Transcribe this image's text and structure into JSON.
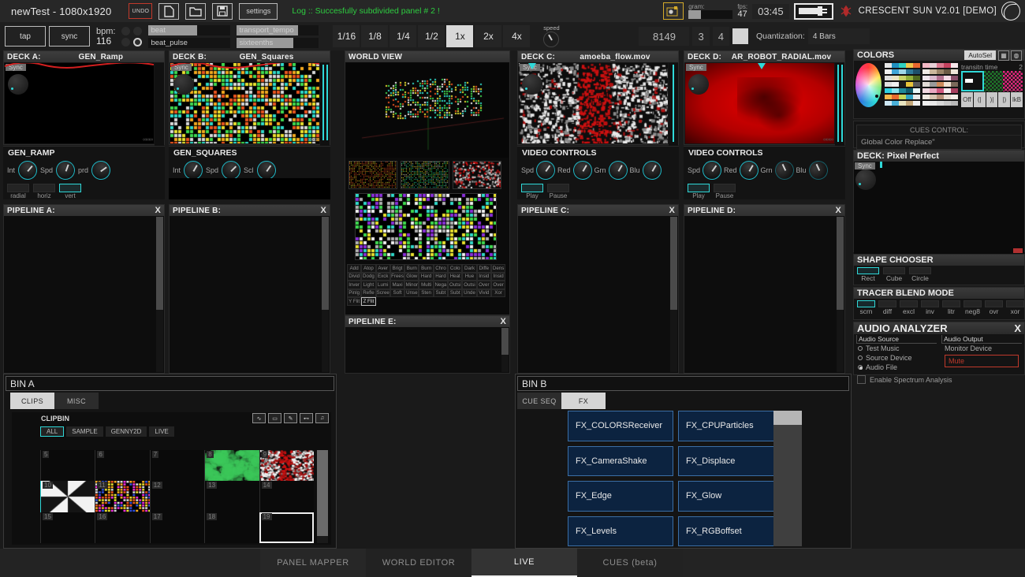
{
  "topbar": {
    "project_title": "newTest - 1080x1920",
    "undo_label": "UNDO",
    "new_icon": "new-document-icon",
    "open_icon": "open-folder-icon",
    "save_icon": "save-disk-icon",
    "settings_label": "settings",
    "log_text": "Log :: Succesfully subdivided panel # 2 !",
    "record_icon": "record-icon",
    "gram_label": "gram:",
    "gram_value": 28,
    "fps_label": "fps:",
    "fps_value": "47",
    "clock": "03:45",
    "plug_icon": "plug-icon",
    "bug_icon": "bug-icon",
    "app_name": "CRESCENT SUN V2.01 [DEMO]",
    "logo_icon": "crescent-sun-logo"
  },
  "transport": {
    "tap_label": "tap",
    "sync_label": "sync",
    "bpm_label": "bpm:",
    "bpm_value": "116",
    "slot_beat": "beat",
    "slot_beat_pulse": "beat_pulse",
    "slot_transport_tempo": "transport_tempo",
    "slot_sixteenths": "sixteenths",
    "divisions": [
      "1/16",
      "1/8",
      "1/4",
      "1/2",
      "1x",
      "2x",
      "4x"
    ],
    "active_division": "1x",
    "speed_label": "speed",
    "frame_count": "8149",
    "bar_count": "3",
    "beat_count": "4",
    "quantization_label": "Quantization:",
    "quantization_value": "4 Bars"
  },
  "decks": [
    {
      "id": "A",
      "label": "DECK A:",
      "source": "GEN_Ramp",
      "sync_label": "Sync",
      "ctrl_title": "GEN_RAMP",
      "knobs": [
        {
          "label": "Int",
          "angle": 40
        },
        {
          "label": "Spd",
          "angle": 20
        },
        {
          "label": "prd",
          "angle": 55
        }
      ],
      "buttons": [
        "radial",
        "horiz",
        "vert"
      ],
      "selected_button": "vert"
    },
    {
      "id": "B",
      "label": "DECK B:",
      "source": "GEN_Squares",
      "sync_label": "Sync",
      "ctrl_title": "GEN_SQUARES",
      "knobs": [
        {
          "label": "Int",
          "angle": 30
        },
        {
          "label": "Spd",
          "angle": 45
        },
        {
          "label": "Scl",
          "angle": 35
        }
      ],
      "buttons": [],
      "selected_button": ""
    },
    {
      "id": "C",
      "label": "DECK C:",
      "source": "amoeba_flow.mov",
      "sync_label": "Sync",
      "ctrl_title": "VIDEO CONTROLS",
      "knobs": [
        {
          "label": "Spd",
          "angle": 35
        },
        {
          "label": "Red",
          "angle": 30
        },
        {
          "label": "Grn",
          "angle": 30
        },
        {
          "label": "Blu",
          "angle": 30
        }
      ],
      "buttons": [
        "Play",
        "Pause"
      ],
      "selected_button": "Play"
    },
    {
      "id": "D",
      "label": "DECK D:",
      "source": "AR_ROBOT_RADIAL.mov",
      "sync_label": "Sync",
      "ctrl_title": "VIDEO CONTROLS",
      "knobs": [
        {
          "label": "Spd",
          "angle": 35
        },
        {
          "label": "Red",
          "angle": 30
        },
        {
          "label": "Grn",
          "angle": -20
        },
        {
          "label": "Blu",
          "angle": -20
        }
      ],
      "buttons": [
        "Play",
        "Pause"
      ],
      "selected_button": "Play"
    }
  ],
  "pipelines": [
    {
      "label": "PIPELINE A:",
      "close": "X"
    },
    {
      "label": "PIPELINE B:",
      "close": "X"
    },
    {
      "label": "PIPELINE C:",
      "close": "X"
    },
    {
      "label": "PIPELINE D:",
      "close": "X"
    },
    {
      "label": "PIPELINE E:",
      "close": "X"
    }
  ],
  "worldview": {
    "title": "WORLD VIEW",
    "blend_modes": [
      "Add",
      "Atop",
      "Aver",
      "Brigt",
      "Burn",
      "Burn",
      "Chro",
      "Colo",
      "Dark",
      "Diffe",
      "Dens",
      "Divid",
      "Dodg",
      "Exck",
      "Frees",
      "Glow",
      "Hard",
      "Hard",
      "Heat",
      "Hue",
      "Insid",
      "Insid",
      "Inver",
      "Light",
      "Lumi",
      "Maxi",
      "Minor",
      "Multi",
      "Nega",
      "Outsi",
      "Outsi",
      "Over",
      "Over",
      "Pinlg",
      "Refle",
      "Scree",
      "Soft",
      "Unse",
      "Sten",
      "Subt",
      "Subt",
      "Unde",
      "Vivid",
      "Xor",
      "Y Flit",
      "Z Flit"
    ],
    "selected_blend_mode": "Z Flit"
  },
  "colors": {
    "title": "COLORS",
    "autosel_label": "AutoSel",
    "icon1": "grid-icon",
    "icon2": "globe-icon",
    "transition_time_label": "transitn time",
    "transition_time_value": "2",
    "phase_buttons": [
      "Off",
      "(|",
      ")|",
      "|)",
      "lkB"
    ],
    "selected_phase": "Off",
    "cues_control_label": "CUES CONTROL:",
    "cues_control_value": "Global Color Replace\""
  },
  "pixel_perfect": {
    "title": "DECK: Pixel Perfect",
    "sync_label": "Sync"
  },
  "shape_chooser": {
    "title": "SHAPE CHOOSER",
    "options": [
      "Rect",
      "Cube",
      "Circle"
    ],
    "selected": "Rect"
  },
  "tracer_blend": {
    "title": "TRACER BLEND MODE",
    "options": [
      "scrn",
      "diff",
      "excl",
      "inv",
      "litr",
      "neg8",
      "ovr",
      "xor"
    ],
    "selected": "scrn"
  },
  "audio_analyzer": {
    "title": "AUDIO ANALYZER",
    "close": "X",
    "source_header": "Audio Source",
    "source_options": [
      "Test Music",
      "Source Device",
      "Audio File"
    ],
    "selected_source": "Audio File",
    "output_header": "Audio Output",
    "output_options": [
      "Monitor Device"
    ],
    "mute_label": "Mute",
    "spectrum_label": "Enable Spectrum Analysis",
    "spectrum_enabled": false
  },
  "bin_a": {
    "title": "BIN A",
    "tabs": [
      "CLIPS",
      "MISC"
    ],
    "active_tab": "CLIPS",
    "clipbin_label": "CLIPBIN",
    "icons": [
      "wav-icon",
      "video-icon",
      "tag-icon",
      "midi-icon",
      "audio-note-icon"
    ],
    "filters": [
      "ALL",
      "SAMPLE",
      "GENNY2D",
      "LIVE"
    ],
    "active_filter": "ALL",
    "cells": [
      {
        "num": "5",
        "type": "empty"
      },
      {
        "num": "6",
        "type": "empty"
      },
      {
        "num": "7",
        "type": "empty"
      },
      {
        "num": "8",
        "type": "green"
      },
      {
        "num": "9",
        "type": "amoeba"
      },
      {
        "num": "10",
        "type": "pinwheel",
        "selected": true
      },
      {
        "num": "11",
        "type": "squares"
      },
      {
        "num": "12",
        "type": "empty"
      },
      {
        "num": "13",
        "type": "empty"
      },
      {
        "num": "14",
        "type": "empty"
      },
      {
        "num": "15",
        "type": "empty"
      },
      {
        "num": "16",
        "type": "empty"
      },
      {
        "num": "17",
        "type": "empty"
      },
      {
        "num": "18",
        "type": "empty"
      },
      {
        "num": "19",
        "type": "empty",
        "white_selected": true
      }
    ]
  },
  "bin_b": {
    "title": "BIN B",
    "tabs": [
      "CUE SEQ",
      "FX"
    ],
    "active_tab": "FX",
    "fx_items": [
      "FX_COLORSReceiver",
      "FX_CPUParticles",
      "FX_CameraShake",
      "FX_Displace",
      "FX_Edge",
      "FX_Glow",
      "FX_Levels",
      "FX_RGBoffset"
    ]
  },
  "bottom_tabs": {
    "items": [
      "PANEL MAPPER",
      "WORLD EDITOR",
      "LIVE",
      "CUES (beta)"
    ],
    "active": "LIVE"
  },
  "theme": {
    "accent_cyan": "#2fd8d8",
    "accent_red": "#c0392b",
    "log_green": "#2ecc40",
    "fx_blue": "#0c2340"
  }
}
